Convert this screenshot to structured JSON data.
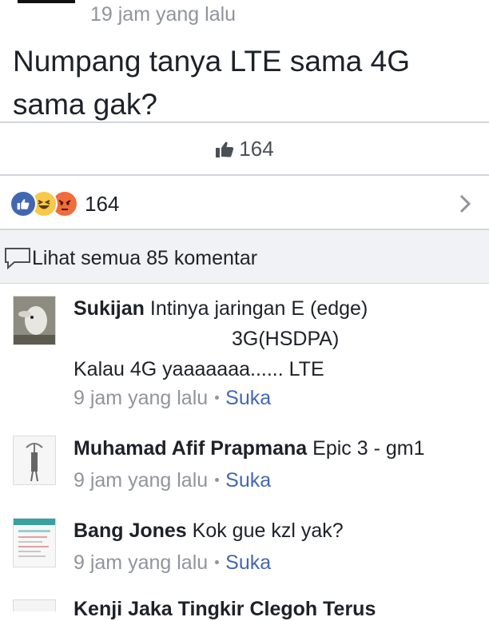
{
  "post": {
    "time": "19 jam yang lalu",
    "text": "Numpang tanya LTE sama 4G sama gak?"
  },
  "likes": {
    "icon": "thumbs-up-icon",
    "count": "164"
  },
  "reactions": {
    "icons": [
      "like-reaction-icon",
      "haha-reaction-icon",
      "angry-reaction-icon"
    ],
    "count": "164",
    "colors": {
      "like": "#4267b2",
      "haha": "#f7c94a",
      "angry": "#f26b3a"
    }
  },
  "comments_link": {
    "label": "Lihat semua 85 komentar"
  },
  "comments": [
    {
      "name": "Sukijan",
      "text_lines": [
        "Intinya jaringan E (edge)",
        "3G(HSDPA)",
        "Kalau 4G yaaaaaaa...... LTE"
      ],
      "time": "9 jam yang lalu",
      "like": "Suka"
    },
    {
      "name": "Muhamad Afif Prapmana",
      "text_lines": [
        "Epic 3 - gm1"
      ],
      "time": "9 jam yang lalu",
      "like": "Suka"
    },
    {
      "name": "Bang Jones",
      "text_lines": [
        "Kok gue kzl yak?"
      ],
      "time": "9 jam yang lalu",
      "like": "Suka"
    }
  ],
  "cutoff_comment": {
    "text": "Kenji Jaka Tingkir Clegoh Terus"
  },
  "colors": {
    "link": "#4267b2",
    "meta": "#90949c",
    "divider": "#d3d6db",
    "bar": "#f1f2f5"
  }
}
